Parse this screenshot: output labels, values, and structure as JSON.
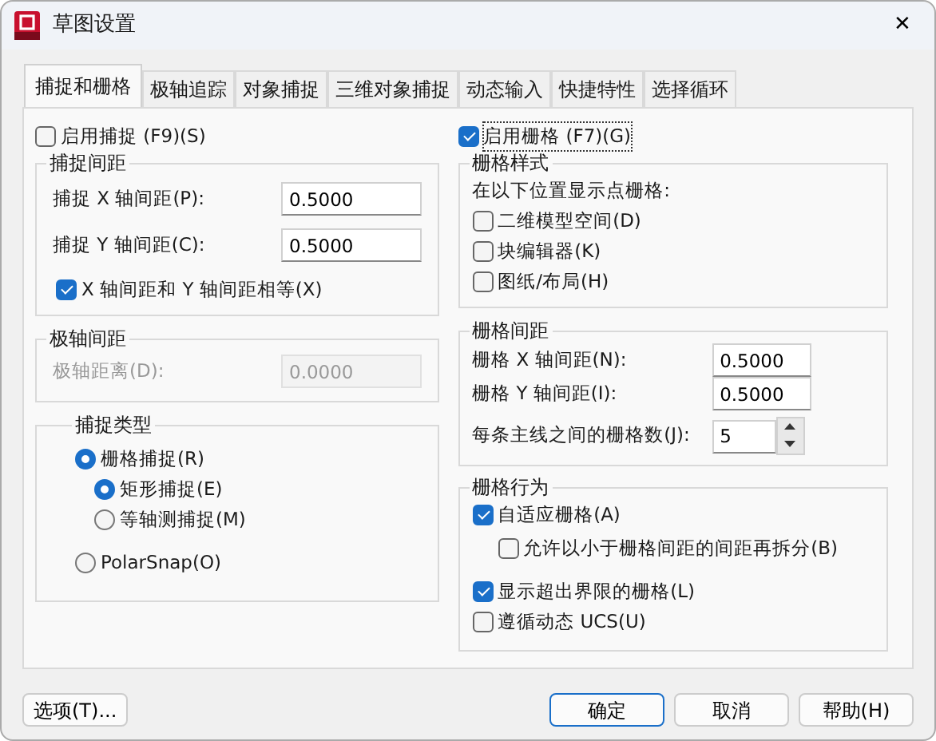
{
  "window": {
    "title": "草图设置",
    "close": "✕"
  },
  "tabs": [
    {
      "label": "捕捉和栅格",
      "selected": true
    },
    {
      "label": "极轴追踪",
      "selected": false
    },
    {
      "label": "对象捕捉",
      "selected": false
    },
    {
      "label": "三维对象捕捉",
      "selected": false
    },
    {
      "label": "动态输入",
      "selected": false
    },
    {
      "label": "快捷特性",
      "selected": false
    },
    {
      "label": "选择循环",
      "selected": false
    }
  ],
  "snap_on": {
    "label": "启用捕捉 (F9)(S)",
    "checked": false
  },
  "snap_spacing": {
    "title": "捕捉间距",
    "fields": [
      {
        "label": "捕捉 X 轴间距(P):",
        "value": "0.5000"
      },
      {
        "label": "捕捉 Y 轴间距(C):",
        "value": "0.5000"
      }
    ],
    "equal": {
      "label": "X 轴间距和 Y 轴间距相等(X)",
      "checked": true
    }
  },
  "polar_spacing": {
    "title": "极轴间距",
    "field": {
      "label": "极轴距离(D):",
      "value": "0.0000",
      "disabled": true
    }
  },
  "snap_type": {
    "title": "捕捉类型",
    "options": [
      {
        "label": "栅格捕捉(R)",
        "selected": true,
        "children": [
          {
            "label": "矩形捕捉(E)",
            "selected": true
          },
          {
            "label": "等轴测捕捉(M)",
            "selected": false
          }
        ]
      },
      {
        "label": "PolarSnap(O)",
        "selected": false
      }
    ]
  },
  "grid_on": {
    "label": "启用栅格 (F7)(G)",
    "checked": true
  },
  "grid_style": {
    "title": "栅格样式",
    "caption": "在以下位置显示点栅格:",
    "options": [
      {
        "label": "二维模型空间(D)",
        "checked": false
      },
      {
        "label": "块编辑器(K)",
        "checked": false
      },
      {
        "label": "图纸/布局(H)",
        "checked": false
      }
    ]
  },
  "grid_spacing": {
    "title": "栅格间距",
    "fields": [
      {
        "label": "栅格 X 轴间距(N):",
        "value": "0.5000"
      },
      {
        "label": "栅格 Y 轴间距(I):",
        "value": "0.5000"
      }
    ],
    "major": {
      "label": "每条主线之间的栅格数(J):",
      "value": "5"
    }
  },
  "grid_behavior": {
    "title": "栅格行为",
    "options": [
      {
        "label": "自适应栅格(A)",
        "checked": true,
        "children": [
          {
            "label": "允许以小于栅格间距的间距再拆分(B)",
            "checked": false
          }
        ]
      },
      {
        "label": "显示超出界限的栅格(L)",
        "checked": true
      },
      {
        "label": "遵循动态 UCS(U)",
        "checked": false
      }
    ]
  },
  "buttons": [
    {
      "label": "选项(T)...",
      "kind": "secondary"
    },
    {
      "label": "确定",
      "kind": "default"
    },
    {
      "label": "取消",
      "kind": "secondary"
    },
    {
      "label": "帮助(H)",
      "kind": "secondary"
    }
  ]
}
